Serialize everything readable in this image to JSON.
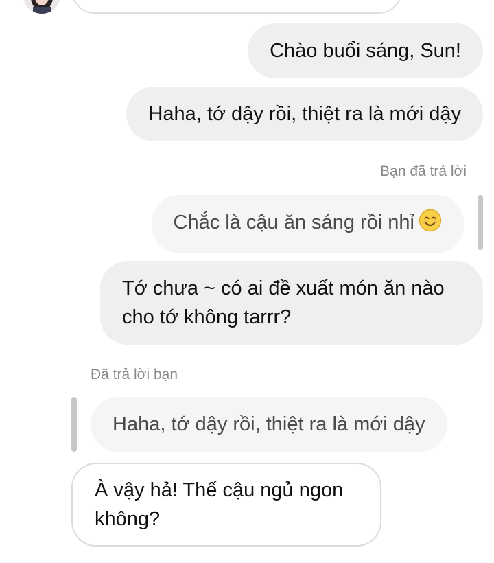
{
  "conversation": {
    "messages": [
      {
        "type": "sent",
        "text": "Chào buổi sáng, Sun!"
      },
      {
        "type": "sent",
        "text": "Haha, tớ dậy rồi, thiệt ra là mới dậy"
      },
      {
        "type": "reply_label_sent",
        "text": "Bạn đã trả lời"
      },
      {
        "type": "quoted_sent",
        "text": "Chắc là cậu ăn sáng rồi nhỉ",
        "emoji": "smiling-face-emoji"
      },
      {
        "type": "sent",
        "text": "Tớ chưa ~ có ai đề xuất món ăn nào cho tớ không tarrr?"
      },
      {
        "type": "reply_label_received",
        "text": "Đã trả lời bạn"
      },
      {
        "type": "quoted_received",
        "text": "Haha, tớ dậy rồi, thiệt ra là mới dậy"
      },
      {
        "type": "received",
        "text": "À vậy hả! Thế cậu ngủ ngon không?"
      }
    ]
  },
  "colors": {
    "sent_bubble": "#efefef",
    "quoted_bubble": "#f5f5f5",
    "received_border": "#dcdcdc",
    "meta_text": "#8a8a8a",
    "quote_bar": "#c7c7c7"
  }
}
